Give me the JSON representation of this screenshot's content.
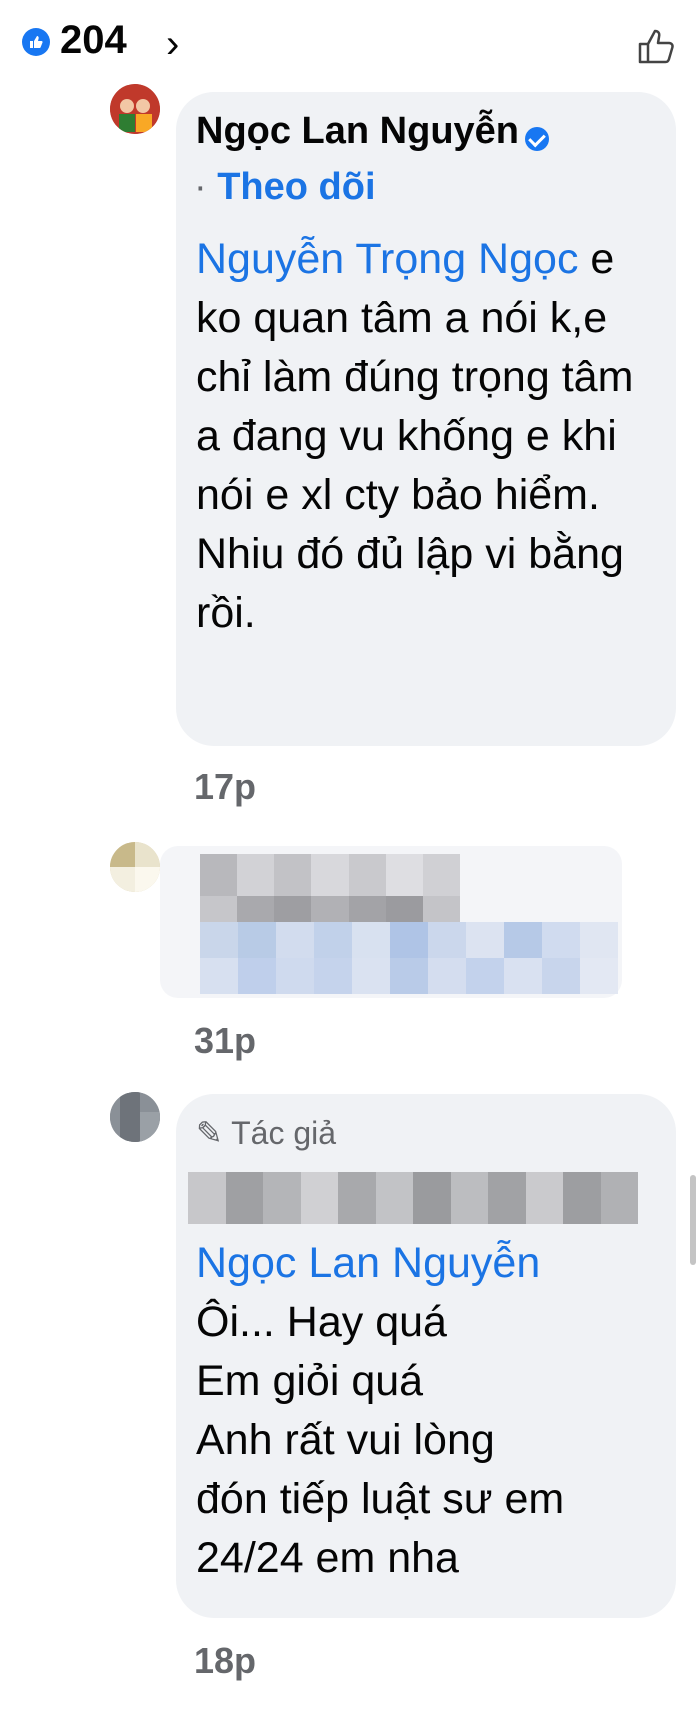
{
  "reactions": {
    "count": "204",
    "chevron": "›",
    "icon": "like-icon"
  },
  "comments": [
    {
      "author": "Ngọc Lan Nguyễn",
      "verified": true,
      "follow_label": "Theo dõi",
      "mention": "Nguyễn Trọng Ngọc",
      "text": " e ko quan tâm a nói k,e chỉ làm đúng trọng tâm a đang vu khống e khi nói e xl cty bảo hiểm. Nhiu đó đủ lập vi bằng rồi.",
      "time": "17p"
    },
    {
      "author": "",
      "blurred": true,
      "time": "31p"
    },
    {
      "author_tag": "Tác giả",
      "author_blurred": true,
      "mention": "Ngọc Lan Nguyễn",
      "lines": [
        "Ôi... Hay quá",
        "Em giỏi quá",
        "Anh rất vui lòng",
        "đón tiếp luật sư em",
        "24/24 em nha"
      ],
      "time": "18p"
    }
  ],
  "colors": {
    "accent": "#1b74e4",
    "bubble": "#f0f2f5",
    "meta": "#65676b"
  }
}
